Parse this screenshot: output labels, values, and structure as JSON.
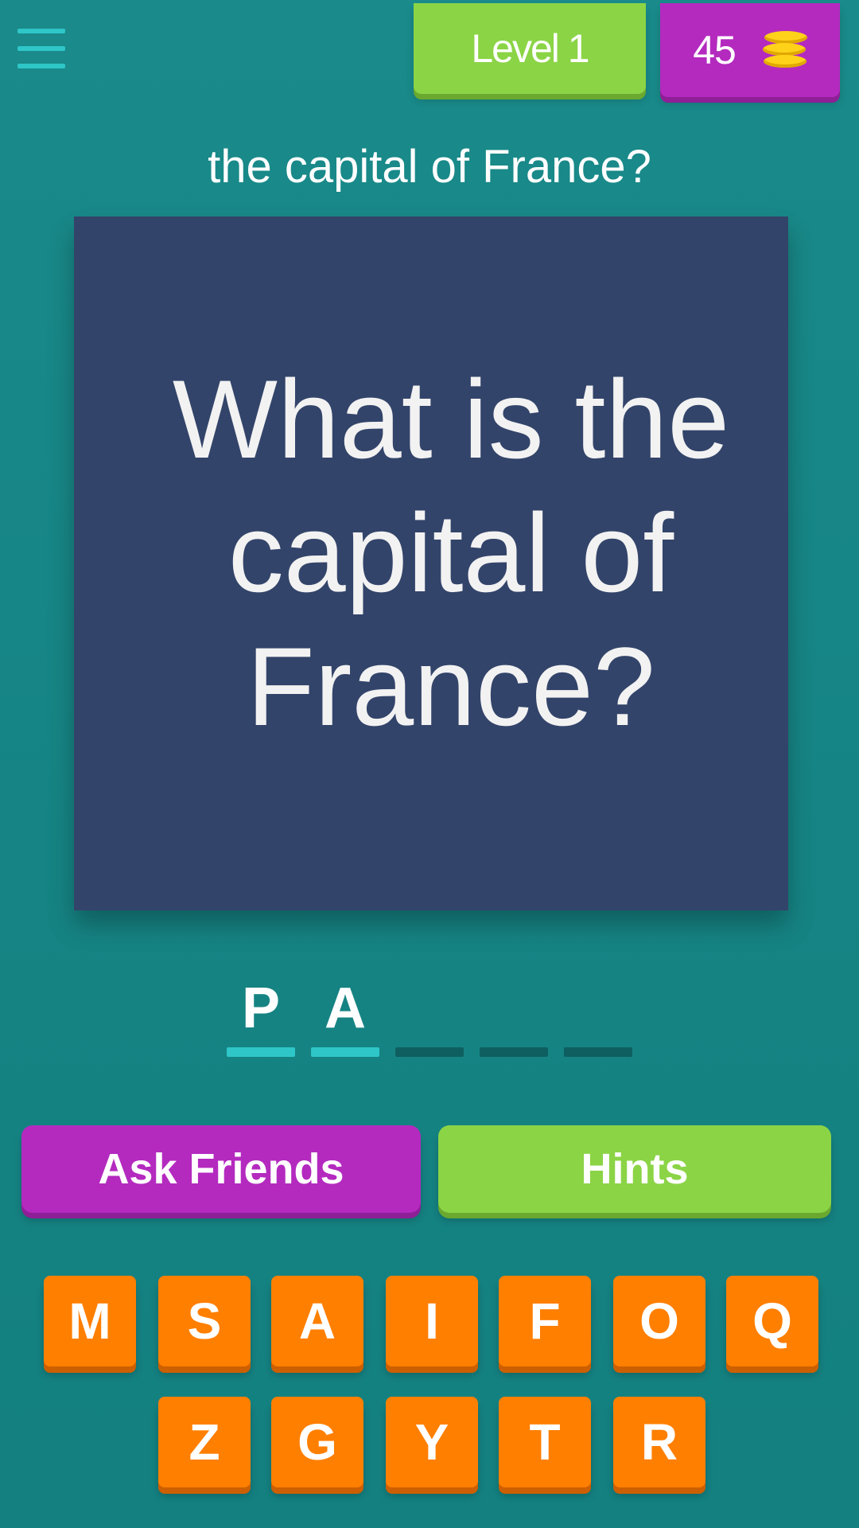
{
  "header": {
    "menu_icon": "hamburger-menu-icon",
    "level_label": "Level 1",
    "coins": "45",
    "coins_icon": "coin-stack-icon"
  },
  "question": {
    "text": "the capital of France?",
    "picture_text": "What is the capital of France?"
  },
  "answer": {
    "slots": [
      {
        "letter": "P",
        "filled": true
      },
      {
        "letter": "A",
        "filled": true
      },
      {
        "letter": "",
        "filled": false
      },
      {
        "letter": "",
        "filled": false
      },
      {
        "letter": "",
        "filled": false
      }
    ]
  },
  "actions": {
    "ask_friends_label": "Ask Friends",
    "hints_label": "Hints"
  },
  "keyboard": {
    "row1": [
      "M",
      "S",
      "A",
      "I",
      "F",
      "O",
      "Q"
    ],
    "row2": [
      "Z",
      "G",
      "Y",
      "T",
      "R"
    ]
  },
  "colors": {
    "background": "#168484",
    "level_badge": "#8bd446",
    "coins_badge": "#b42abf",
    "picture_card": "#33446a",
    "key": "#ff7f00",
    "slot_filled": "#2fc6c8",
    "slot_empty": "#0f5f60"
  }
}
